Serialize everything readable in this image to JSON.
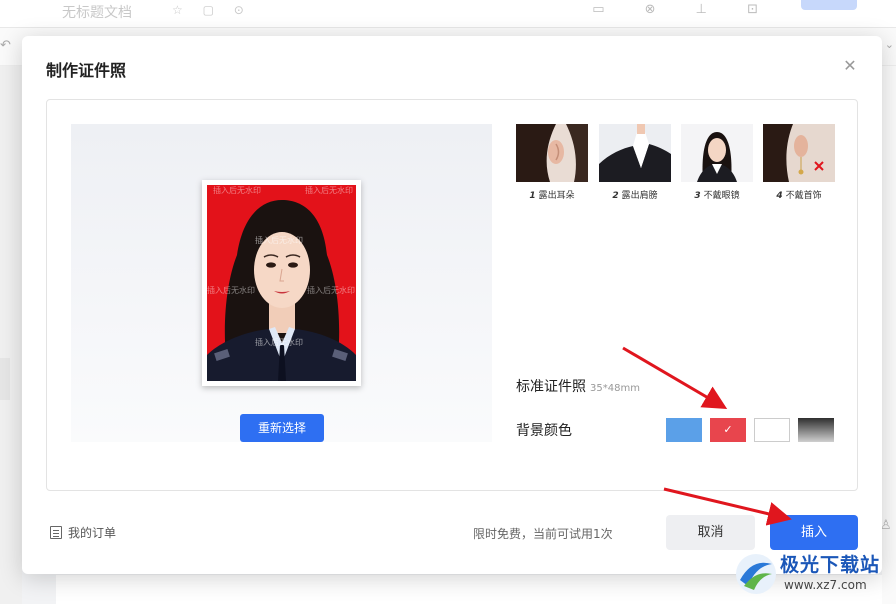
{
  "background": {
    "doc_title": "无标题文档",
    "doc_title_icons": "☆ ▢ ⊙",
    "right_icons": "▭ ⊗ ⊥ ⊡"
  },
  "dialog": {
    "title": "制作证件照",
    "close_glyph": "✕",
    "reselect_label": "重新选择",
    "photo_watermark": "插入后无水印",
    "tips": [
      {
        "num": "1",
        "label": "露出耳朵"
      },
      {
        "num": "2",
        "label": "露出肩膀"
      },
      {
        "num": "3",
        "label": "不戴眼镜"
      },
      {
        "num": "4",
        "label": "不戴首饰"
      }
    ],
    "standard_label": "标准证件照",
    "standard_size": "35*48mm",
    "bg_color_label": "背景颜色",
    "swatches": [
      {
        "name": "blue",
        "color": "#5ba0e8"
      },
      {
        "name": "red",
        "color": "#e8454d",
        "selected": true,
        "check": "✓"
      },
      {
        "name": "white",
        "color": "#ffffff"
      },
      {
        "name": "gray-gradient",
        "color": "#7a7a7a"
      }
    ],
    "orders_label": "我的订单",
    "free_note": "限时免费，当前可试用1次",
    "cancel_label": "取消",
    "insert_label": "插入"
  },
  "watermark": {
    "brand": "极光下载站",
    "url": "www.xz7.com"
  },
  "colors": {
    "primary": "#2e6ff2",
    "annotation_arrow": "#e0161e",
    "photo_bg": "#e3121a"
  }
}
